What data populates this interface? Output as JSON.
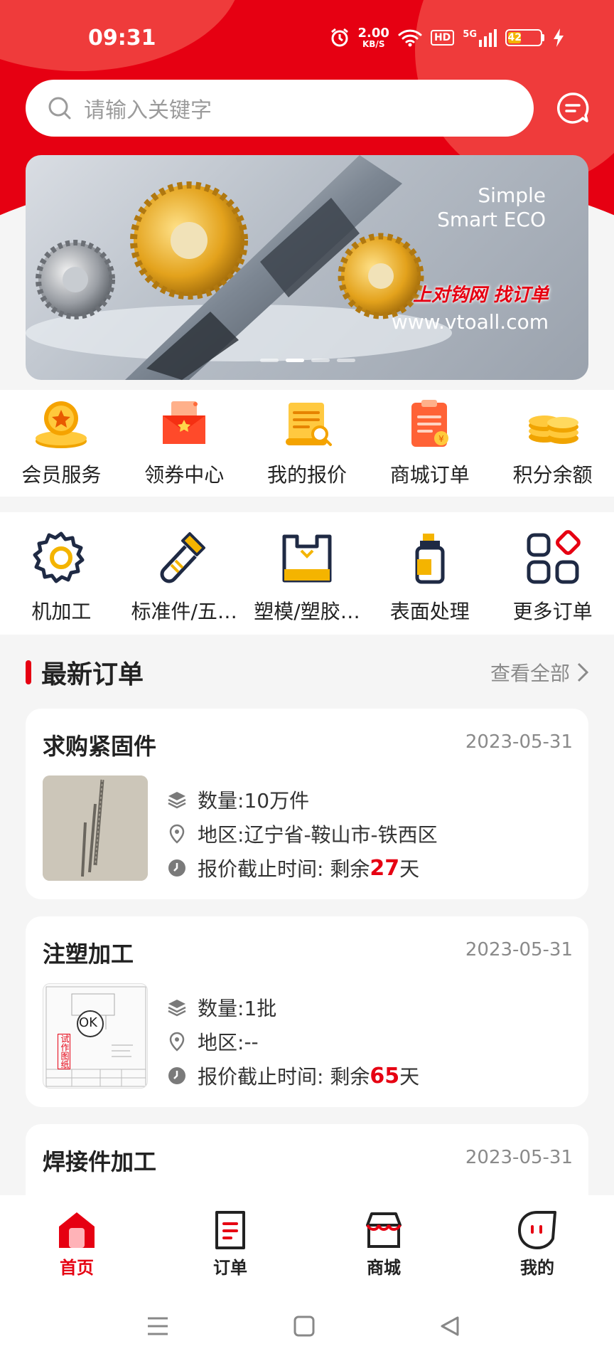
{
  "status_bar": {
    "time": "09:31",
    "net_speed_value": "2.00",
    "net_speed_unit": "KB/S",
    "hd": "HD",
    "signal": "5G",
    "battery": "42"
  },
  "search": {
    "placeholder": "请输入关键字"
  },
  "banner": {
    "line1": "Simple",
    "line2": "Smart ECO",
    "slogan": "上对钩网  找订单",
    "url": "www.vtoall.com"
  },
  "quick_menu": [
    {
      "label": "会员服务",
      "icon": "member-medal-icon"
    },
    {
      "label": "领券中心",
      "icon": "coupon-envelope-icon"
    },
    {
      "label": "我的报价",
      "icon": "quote-scroll-icon"
    },
    {
      "label": "商城订单",
      "icon": "mall-order-icon"
    },
    {
      "label": "积分余额",
      "icon": "coins-icon"
    }
  ],
  "categories": [
    {
      "label": "机加工",
      "icon": "gear-icon"
    },
    {
      "label": "标准件/五…",
      "icon": "bolt-icon"
    },
    {
      "label": "塑模/塑胶…",
      "icon": "plastic-bag-icon"
    },
    {
      "label": "表面处理",
      "icon": "spray-bottle-icon"
    },
    {
      "label": "更多订单",
      "icon": "grid-more-icon"
    }
  ],
  "section": {
    "title": "最新订单",
    "more": "查看全部"
  },
  "orders": [
    {
      "name": "求购紧固件",
      "date": "2023-05-31",
      "qty_label": "数量:",
      "qty": "10万件",
      "region_label": "地区:",
      "region": "辽宁省-鞍山市-铁西区",
      "deadline_label": "报价截止时间:",
      "remain_prefix": "剩余",
      "remain_days": "27",
      "remain_suffix": "天"
    },
    {
      "name": "注塑加工",
      "date": "2023-05-31",
      "qty_label": "数量:",
      "qty": "1批",
      "region_label": "地区:",
      "region": "--",
      "deadline_label": "报价截止时间:",
      "remain_prefix": "剩余",
      "remain_days": "65",
      "remain_suffix": "天",
      "thumb_text": "OK",
      "thumb_stamp": "试作图纸"
    },
    {
      "name": "焊接件加工",
      "date": "2023-05-31"
    }
  ],
  "tabbar": [
    {
      "label": "首页",
      "icon": "home-icon",
      "active": true
    },
    {
      "label": "订单",
      "icon": "order-doc-icon",
      "active": false
    },
    {
      "label": "商城",
      "icon": "store-icon",
      "active": false
    },
    {
      "label": "我的",
      "icon": "profile-icon",
      "active": false
    }
  ],
  "colors": {
    "brand_red": "#e60012",
    "gold": "#f4b400",
    "navy": "#1f2a44"
  }
}
